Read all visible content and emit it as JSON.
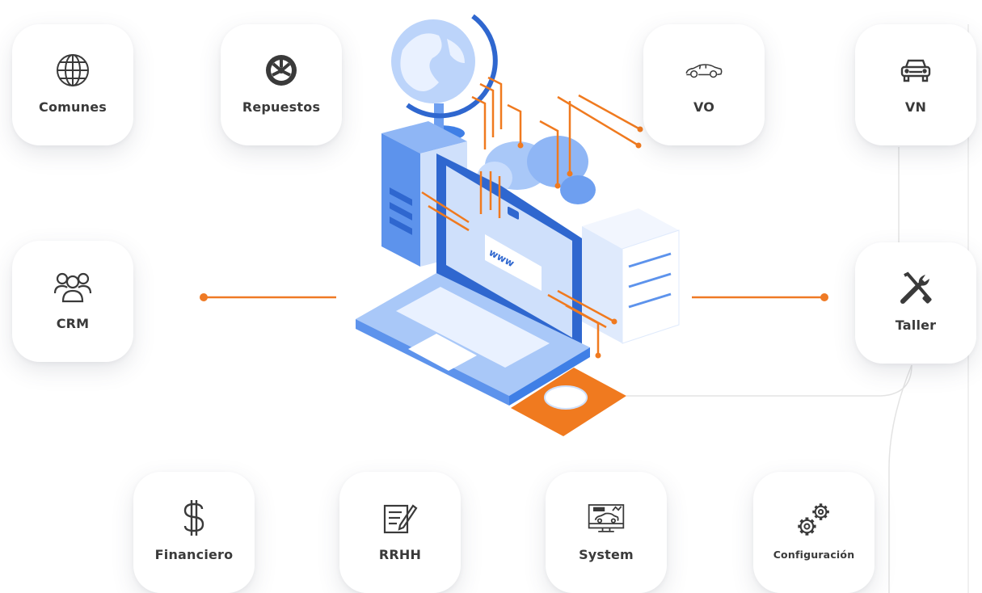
{
  "modules": {
    "comunes": {
      "label": "Comunes",
      "icon": "globe-icon"
    },
    "repuestos": {
      "label": "Repuestos",
      "icon": "wheel-icon"
    },
    "vo": {
      "label": "VO",
      "icon": "sports-car-icon"
    },
    "vn": {
      "label": "VN",
      "icon": "car-front-icon"
    },
    "crm": {
      "label": "CRM",
      "icon": "people-group-icon"
    },
    "taller": {
      "label": "Taller",
      "icon": "tools-icon"
    },
    "financiero": {
      "label": "Financiero",
      "icon": "dollar-icon"
    },
    "rrhh": {
      "label": "RRHH",
      "icon": "document-pen-icon"
    },
    "system": {
      "label": "System",
      "icon": "monitor-car-icon"
    },
    "configuracion": {
      "label": "Configuración",
      "icon": "gears-icon"
    }
  },
  "illustration": {
    "browser_text": "www",
    "accent_color": "#f07a1f",
    "primary_blue": "#3f7fe6",
    "light_blue": "#cfe0fb"
  }
}
